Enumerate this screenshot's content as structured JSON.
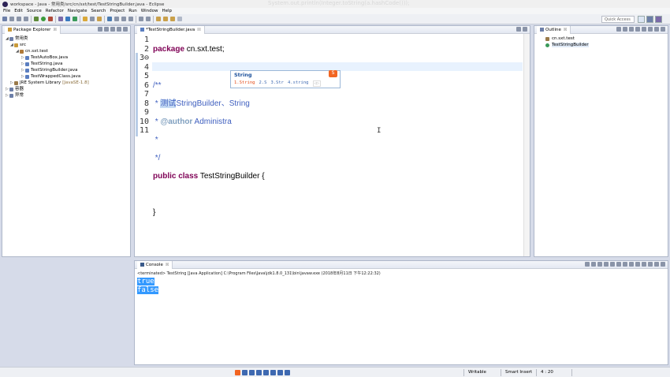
{
  "window": {
    "title": "workspace - Java - 常用类/src/cn/sxt/test/TestStringBuilder.java - Eclipse",
    "ghost_text": "System.out.println(Integer.toString(a.hashCode()));"
  },
  "menu": [
    "File",
    "Edit",
    "Source",
    "Refactor",
    "Navigate",
    "Search",
    "Project",
    "Run",
    "Window",
    "Help"
  ],
  "toolbar": {
    "quick_access": "Quick Access"
  },
  "package_explorer": {
    "tab_label": "Package Explorer",
    "tab_close": "☒",
    "items": [
      {
        "label": "常用类",
        "arrow": "◢",
        "decor": ""
      },
      {
        "label": "src",
        "arrow": "◢",
        "decor": ""
      },
      {
        "label": "cn.sxt.test",
        "arrow": "◢",
        "decor": ""
      },
      {
        "label": "TestAutoBox.java",
        "arrow": "▷",
        "decor": ""
      },
      {
        "label": "TestString.java",
        "arrow": "▷",
        "decor": ""
      },
      {
        "label": "TestStringBuilder.java",
        "arrow": "▷",
        "decor": ""
      },
      {
        "label": "TestWrappedClass.java",
        "arrow": "▷",
        "decor": ""
      },
      {
        "label": "JRE System Library",
        "arrow": "▷",
        "decor": "[JavaSE-1.8]"
      },
      {
        "label": "容器",
        "arrow": "▷",
        "decor": ""
      },
      {
        "label": "异常",
        "arrow": "▷",
        "decor": ""
      }
    ]
  },
  "editor": {
    "tab_label": "*TestStringBuilder.java",
    "tab_close": "☒",
    "line_numbers": [
      "1",
      "2",
      "3⊖",
      "4",
      "5",
      "6",
      "7",
      "8",
      "9",
      "10",
      "11"
    ],
    "lines": {
      "l1_kw": "package",
      "l1_rest": " cn.sxt.test;",
      "l3": "/**",
      "l4_a": " * ",
      "l4_sel": "测试",
      "l4_b": "StringBuilder、String",
      "l5_a": " * ",
      "l5_tag": "@author",
      "l5_b": " Administra",
      "l6": " *",
      "l7": " */",
      "l8_kw": "public class",
      "l8_rest": " TestStringBuilder {",
      "l10": "}"
    },
    "ibeam": "I"
  },
  "ime_popup": {
    "composition": "String",
    "logo": "S",
    "candidates": [
      "1.String",
      "2.S",
      "3.Str",
      "4.string"
    ],
    "pager": "◁▷"
  },
  "outline": {
    "tab_label": "Outline",
    "tab_close": "☒",
    "items": [
      {
        "label": "cn.sxt.test"
      },
      {
        "label": "TestStringBuilder"
      }
    ]
  },
  "console": {
    "tab_label": "Console",
    "tab_close": "☒",
    "info": "<terminated> TestString [Java Application] C:\\Program Files\\Java\\jdk1.8.0_131\\bin\\javaw.exe (2018年8月11日 下午12:22:32)",
    "output": [
      "true",
      "false"
    ]
  },
  "status": {
    "writable": "Writable",
    "insert_mode": "Smart Insert",
    "position": "4 : 20"
  },
  "colors": {
    "keyword": "#7f0055",
    "comment": "#3f5fbf",
    "selection": "#3399ff",
    "ime_orange": "#f26522"
  }
}
